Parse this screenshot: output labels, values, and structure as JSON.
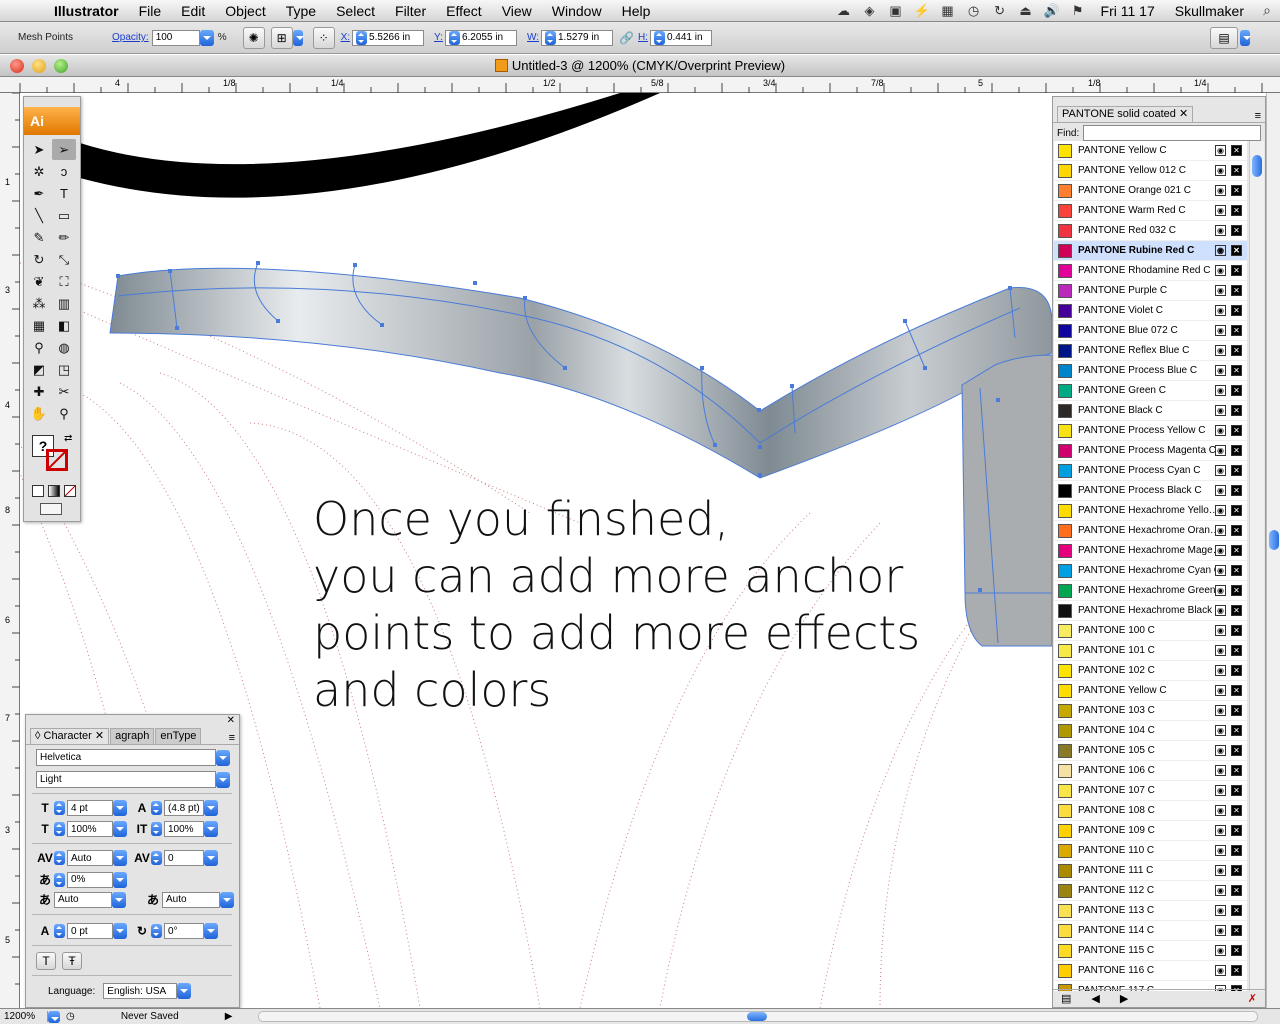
{
  "menubar": {
    "app": "Illustrator",
    "menus": [
      "File",
      "Edit",
      "Object",
      "Type",
      "Select",
      "Filter",
      "Effect",
      "View",
      "Window",
      "Help"
    ],
    "clock": "Fri 11 17",
    "user": "Skullmaker"
  },
  "control": {
    "mode_label": "Mesh Points",
    "opacity_label": "Opacity:",
    "opacity_value": "100",
    "opacity_unit": "%",
    "x_label": "X:",
    "x_value": "5.5266 in",
    "y_label": "Y:",
    "y_value": "6.2055 in",
    "w_label": "W:",
    "w_value": "1.5279 in",
    "h_label": "H:",
    "h_value": "0.441 in"
  },
  "window": {
    "title": "Untitled-3 @ 1200% (CMYK/Overprint Preview)"
  },
  "ruler_top": [
    "4",
    "1/8",
    "1/4",
    "1/2",
    "5/8",
    "3/4",
    "7/8",
    "5",
    "1/8",
    "1/4"
  ],
  "ruler_left": [
    "1",
    "3",
    "4",
    "8",
    "6",
    "7",
    "3",
    "5"
  ],
  "canvas": {
    "text_lines": [
      "Once you finshed,",
      "you can add more anchor",
      "points to add more effects",
      "and colors"
    ]
  },
  "tools": {
    "logo": "Ai",
    "items": [
      {
        "name": "selection-tool",
        "glyph": "➤"
      },
      {
        "name": "direct-selection-tool",
        "glyph": "➢"
      },
      {
        "name": "magic-wand-tool",
        "glyph": "✲"
      },
      {
        "name": "lasso-tool",
        "glyph": "ↄ"
      },
      {
        "name": "pen-tool",
        "glyph": "✒"
      },
      {
        "name": "type-tool",
        "glyph": "T"
      },
      {
        "name": "line-tool",
        "glyph": "╲"
      },
      {
        "name": "rectangle-tool",
        "glyph": "▭"
      },
      {
        "name": "paintbrush-tool",
        "glyph": "✎"
      },
      {
        "name": "pencil-tool",
        "glyph": "✏"
      },
      {
        "name": "rotate-tool",
        "glyph": "↻"
      },
      {
        "name": "scale-tool",
        "glyph": "⤡"
      },
      {
        "name": "warp-tool",
        "glyph": "❦"
      },
      {
        "name": "free-transform-tool",
        "glyph": "⛶"
      },
      {
        "name": "symbol-sprayer-tool",
        "glyph": "⁂"
      },
      {
        "name": "graph-tool",
        "glyph": "▥"
      },
      {
        "name": "mesh-tool",
        "glyph": "▦"
      },
      {
        "name": "gradient-tool",
        "glyph": "◧"
      },
      {
        "name": "eyedropper-tool",
        "glyph": "⚲"
      },
      {
        "name": "blend-tool",
        "glyph": "◍"
      },
      {
        "name": "live-paint-bucket-tool",
        "glyph": "◩"
      },
      {
        "name": "live-paint-selection-tool",
        "glyph": "◳"
      },
      {
        "name": "slice-tool",
        "glyph": "✚"
      },
      {
        "name": "scissors-tool",
        "glyph": "✂"
      },
      {
        "name": "hand-tool",
        "glyph": "✋"
      },
      {
        "name": "zoom-tool",
        "glyph": "⚲"
      }
    ],
    "fill_glyph": "?"
  },
  "character": {
    "tabs": [
      "Character",
      "agraph",
      "enType"
    ],
    "font": "Helvetica",
    "style": "Light",
    "size": "4 pt",
    "leading": "(4.8 pt)",
    "vscale": "100%",
    "hscale": "100%",
    "kerning": "Auto",
    "tracking": "0",
    "tsume": "0%",
    "aki_left": "Auto",
    "aki_right": "Auto",
    "baseline": "0 pt",
    "rotation": "0°",
    "language_label": "Language:",
    "language": "English: USA"
  },
  "swatches": {
    "tab": "PANTONE solid coated",
    "find_label": "Find:",
    "items": [
      {
        "name": "PANTONE Yellow C",
        "color": "#FEE300"
      },
      {
        "name": "PANTONE Yellow 012 C",
        "color": "#FFD700"
      },
      {
        "name": "PANTONE Orange 021 C",
        "color": "#FE7F2D"
      },
      {
        "name": "PANTONE Warm Red C",
        "color": "#F9423A"
      },
      {
        "name": "PANTONE Red 032 C",
        "color": "#EF3340"
      },
      {
        "name": "PANTONE Rubine Red C",
        "color": "#CE0058",
        "selected": true
      },
      {
        "name": "PANTONE Rhodamine Red C",
        "color": "#E10098"
      },
      {
        "name": "PANTONE Purple C",
        "color": "#BB29BB"
      },
      {
        "name": "PANTONE Violet C",
        "color": "#440099"
      },
      {
        "name": "PANTONE Blue 072 C",
        "color": "#10069F"
      },
      {
        "name": "PANTONE Reflex Blue C",
        "color": "#001489"
      },
      {
        "name": "PANTONE Process Blue C",
        "color": "#0085CA"
      },
      {
        "name": "PANTONE Green C",
        "color": "#00AB84"
      },
      {
        "name": "PANTONE Black C",
        "color": "#2D2926"
      },
      {
        "name": "PANTONE Process Yellow C",
        "color": "#F7E214"
      },
      {
        "name": "PANTONE Process Magenta C",
        "color": "#D0006F"
      },
      {
        "name": "PANTONE Process Cyan C",
        "color": "#009FDF"
      },
      {
        "name": "PANTONE Process Black C",
        "color": "#000000"
      },
      {
        "name": "PANTONE Hexachrome Yello…",
        "color": "#FFDC00"
      },
      {
        "name": "PANTONE Hexachrome Oran…",
        "color": "#FF6E1F"
      },
      {
        "name": "PANTONE Hexachrome Mage…",
        "color": "#E4007C"
      },
      {
        "name": "PANTONE Hexachrome Cyan C",
        "color": "#00A0E2"
      },
      {
        "name": "PANTONE Hexachrome Green C",
        "color": "#00A651"
      },
      {
        "name": "PANTONE Hexachrome Black C",
        "color": "#111111"
      },
      {
        "name": "PANTONE 100 C",
        "color": "#F6EB61"
      },
      {
        "name": "PANTONE 101 C",
        "color": "#F7EA48"
      },
      {
        "name": "PANTONE 102 C",
        "color": "#FCE300"
      },
      {
        "name": "PANTONE Yellow C",
        "color": "#FEDD00"
      },
      {
        "name": "PANTONE 103 C",
        "color": "#C5A900"
      },
      {
        "name": "PANTONE 104 C",
        "color": "#AF9800"
      },
      {
        "name": "PANTONE 105 C",
        "color": "#897A27"
      },
      {
        "name": "PANTONE 106 C",
        "color": "#F5E1A4"
      },
      {
        "name": "PANTONE 107 C",
        "color": "#F9E547"
      },
      {
        "name": "PANTONE 108 C",
        "color": "#FBDD40"
      },
      {
        "name": "PANTONE 109 C",
        "color": "#FFD100"
      },
      {
        "name": "PANTONE 110 C",
        "color": "#DAAA00"
      },
      {
        "name": "PANTONE 111 C",
        "color": "#AA8A00"
      },
      {
        "name": "PANTONE 112 C",
        "color": "#9C8412"
      },
      {
        "name": "PANTONE 113 C",
        "color": "#FAE053"
      },
      {
        "name": "PANTONE 114 C",
        "color": "#FBDD40"
      },
      {
        "name": "PANTONE 115 C",
        "color": "#FDDA24"
      },
      {
        "name": "PANTONE 116 C",
        "color": "#FFCD00"
      },
      {
        "name": "PANTONE 117 C",
        "color": "#C99700"
      }
    ]
  },
  "status": {
    "zoom": "1200%",
    "save_state": "Never Saved"
  }
}
